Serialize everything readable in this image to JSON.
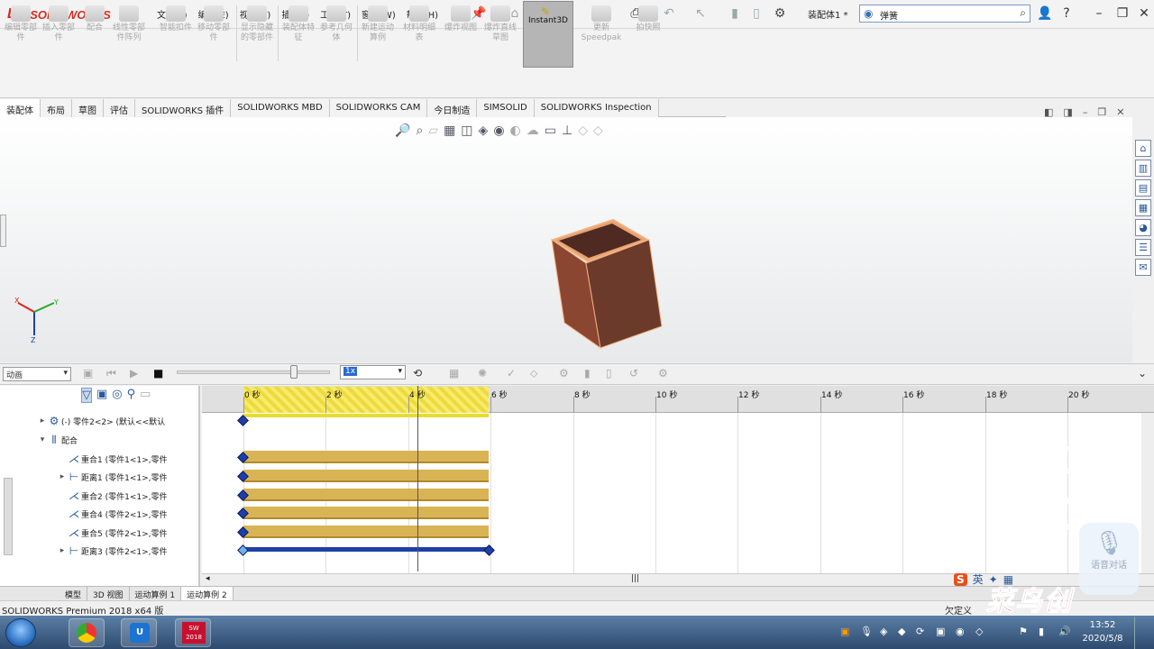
{
  "app": {
    "logo_text": "SOLIDWORKS",
    "logo_mark": "DS",
    "document_name": "装配体1 *",
    "version_status": "SOLIDWORKS Premium 2018 x64 版"
  },
  "menu": [
    "文件(F)",
    "编辑(E)",
    "视图(V)",
    "插入(I)",
    "工具(T)",
    "窗口(W)",
    "帮助(H)"
  ],
  "search": {
    "value": "弹簧"
  },
  "command_manager": [
    {
      "label": "编辑零部件"
    },
    {
      "label": "插入零部件"
    },
    {
      "label": "配合"
    },
    {
      "label": "线性零部件阵列"
    },
    {
      "label": "智能扣件"
    },
    {
      "label": "移动零部件"
    },
    {
      "label": "显示隐藏的零部件"
    },
    {
      "label": "装配体特征"
    },
    {
      "label": "参考几何体"
    },
    {
      "label": "新建运动算例"
    },
    {
      "label": "材料明细表"
    },
    {
      "label": "爆炸视图"
    },
    {
      "label": "爆炸直线草图"
    },
    {
      "label": "Instant3D"
    },
    {
      "label": "更新Speedpak"
    },
    {
      "label": "拍快照"
    }
  ],
  "tabs": [
    "装配体",
    "布局",
    "草图",
    "评估",
    "SOLIDWORKS 插件",
    "SOLIDWORKS MBD",
    "SOLIDWORKS CAM",
    "今日制造",
    "SIMSOLID",
    "SOLIDWORKS Inspection"
  ],
  "motion_study": {
    "study_type": "动画",
    "playback_speed": "1x",
    "tree": [
      {
        "label": "(-) 零件2<2> (默认<<默认",
        "indent": 1,
        "expander": "▸",
        "icon": "part-icon"
      },
      {
        "label": "配合",
        "indent": 1,
        "expander": "▾",
        "icon": "mates-folder-icon"
      },
      {
        "label": "重合1 (零件1<1>,零件",
        "indent": 2,
        "expander": "",
        "icon": "coincident-icon"
      },
      {
        "label": "距离1 (零件1<1>,零件",
        "indent": 2,
        "expander": "▸",
        "icon": "distance-icon"
      },
      {
        "label": "重合2 (零件1<1>,零件",
        "indent": 2,
        "expander": "",
        "icon": "coincident-icon"
      },
      {
        "label": "重合4 (零件2<1>,零件",
        "indent": 2,
        "expander": "",
        "icon": "coincident-icon"
      },
      {
        "label": "重合5 (零件2<1>,零件",
        "indent": 2,
        "expander": "",
        "icon": "coincident-icon"
      },
      {
        "label": "距离3 (零件2<1>,零件",
        "indent": 2,
        "expander": "▸",
        "icon": "distance-icon"
      }
    ],
    "timeline_labels": [
      "0 秒",
      "2 秒",
      "4 秒",
      "6 秒",
      "8 秒",
      "10 秒",
      "12 秒",
      "14 秒",
      "16 秒",
      "18 秒",
      "20 秒"
    ],
    "timeline_end_seconds": 6,
    "current_time_seconds": 4.2
  },
  "bottom_tabs": [
    "模型",
    "3D 视图",
    "运动算例 1",
    "运动算例 2"
  ],
  "active_bottom_tab": "运动算例 2",
  "status": {
    "under_defined": "欠定义"
  },
  "ime": {
    "label": "英"
  },
  "voice_widget": {
    "label": "语音对话"
  },
  "taskbar": {
    "time": "13:52",
    "date": "2020/5/8",
    "pinned": [
      "chrome-icon",
      "app-u-icon",
      "solidworks-2018-icon"
    ],
    "sw_badge": "2018"
  },
  "watermark": "菜鸟创",
  "colors": {
    "part": "#6b3a2a",
    "part_edge": "#e08a55",
    "keyframe": "#1f3fa8",
    "bar": "#d8b455",
    "accent": "#d52b1e"
  }
}
